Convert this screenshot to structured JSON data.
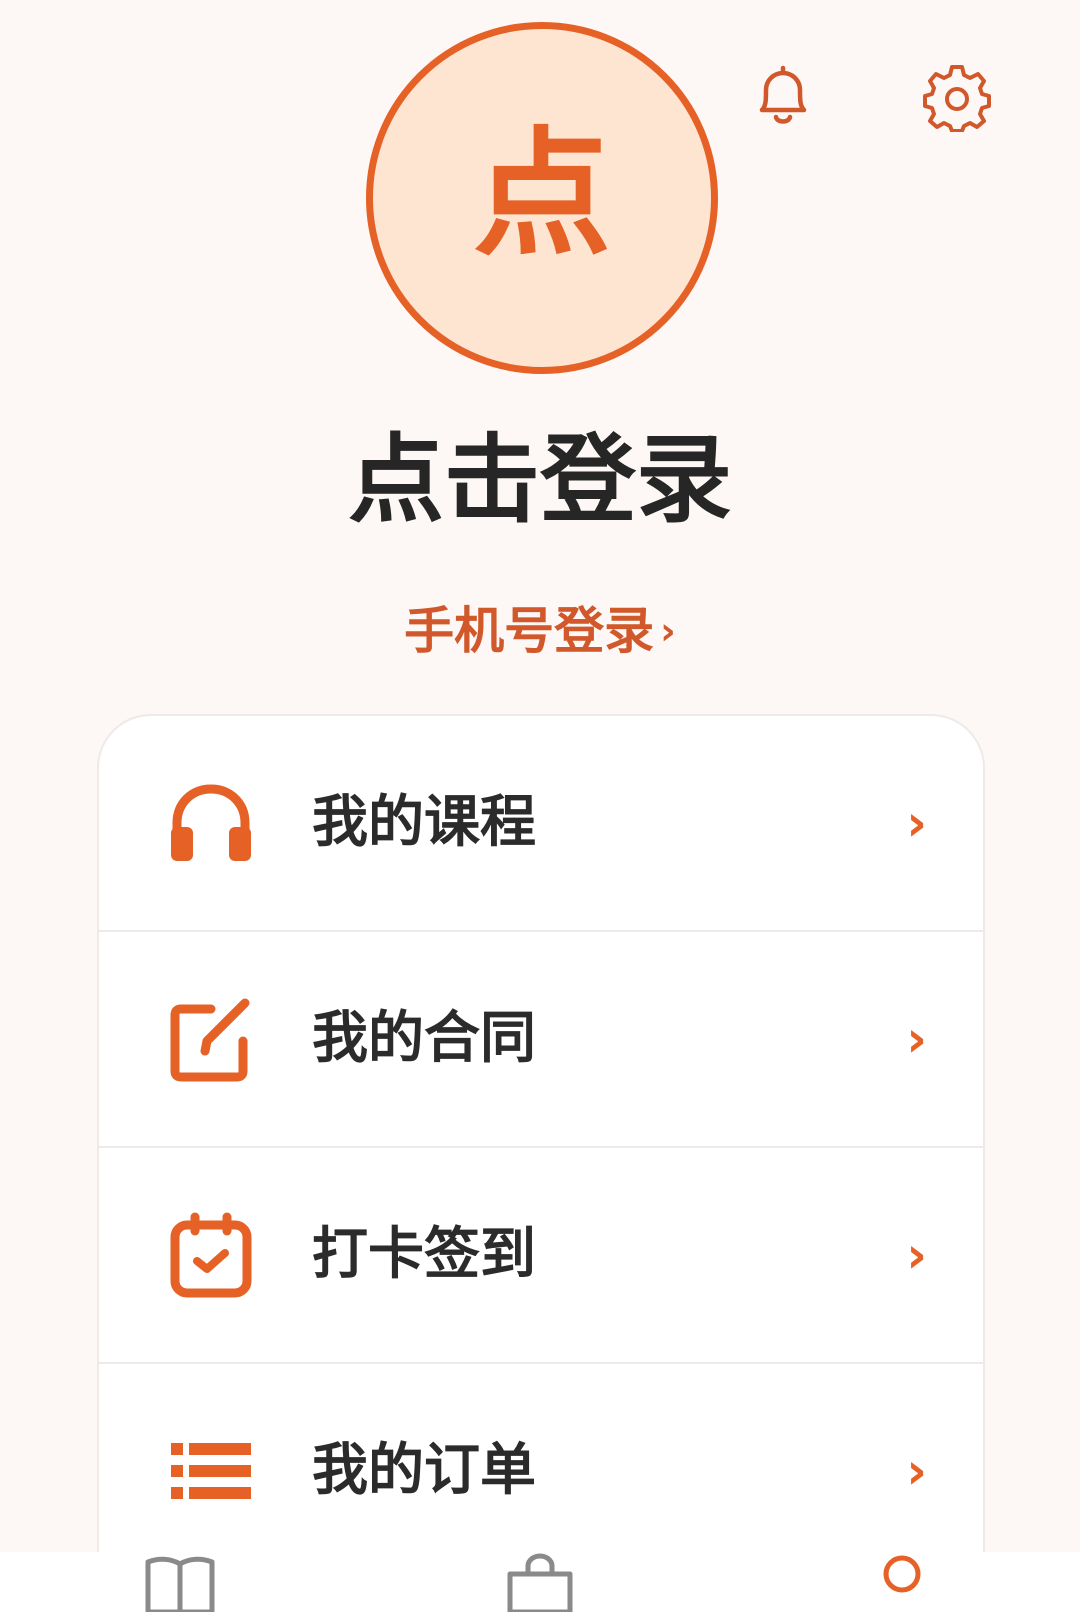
{
  "header": {
    "avatar_char": "点",
    "login_title": "点击登录",
    "phone_login": "手机号登录",
    "phone_login_chevron": "›"
  },
  "icons": {
    "bell": "bell-icon",
    "settings": "gear-icon",
    "course": "headphones-icon",
    "contract": "edit-icon",
    "checkin": "calendar-check-icon",
    "orders": "list-icon"
  },
  "menu": {
    "items": [
      {
        "label": "我的课程",
        "arrow": "›"
      },
      {
        "label": "我的合同",
        "arrow": "›"
      },
      {
        "label": "打卡签到",
        "arrow": "›"
      },
      {
        "label": "我的订单",
        "arrow": "›"
      }
    ]
  },
  "colors": {
    "accent": "#e56126",
    "background": "#fdf7f5",
    "avatar_fill": "#fde5d2",
    "text_primary": "#262626",
    "tab_inactive": "#8a8a8a"
  }
}
